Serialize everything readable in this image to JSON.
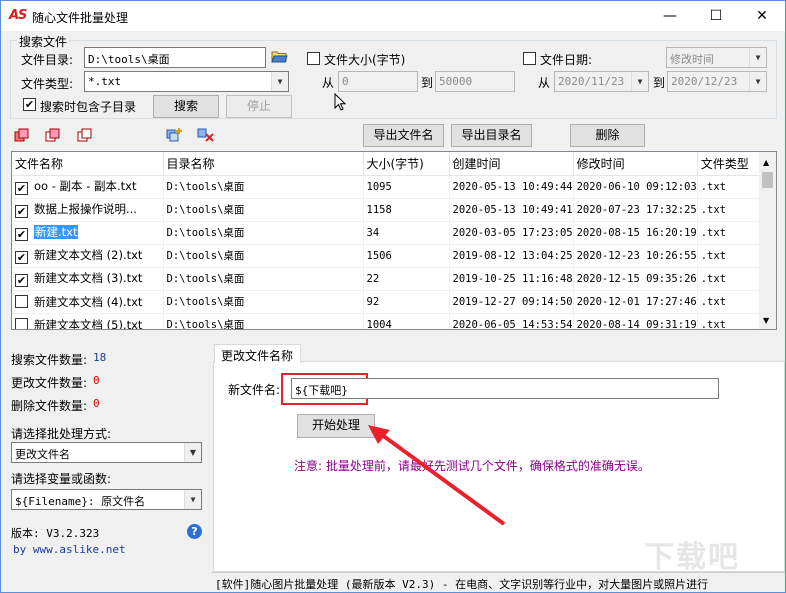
{
  "window": {
    "app_icon": "AS",
    "title": "随心文件批量处理",
    "minimize": "—",
    "maximize": "☐",
    "close": "✕"
  },
  "search": {
    "group_label": "搜索文件",
    "dir_label": "文件目录:",
    "dir_value": "D:\\tools\\桌面",
    "type_label": "文件类型:",
    "type_value": "*.txt",
    "include_sub_label": "搜索时包含子目录",
    "include_sub_checked": "✔",
    "search_button": "搜索",
    "stop_button": "停止",
    "size_label": "文件大小(字节)",
    "size_from_label": "从",
    "size_from_value": "0",
    "size_to_label": "到",
    "size_to_value": "50000",
    "date_label": "文件日期:",
    "date_mode_value": "修改时间",
    "date_from_label": "从",
    "date_from_value": "2020/11/23",
    "date_to_label": "到",
    "date_to_value": "2020/12/23"
  },
  "toolbar": {
    "export_files": "导出文件名",
    "export_dirs": "导出目录名",
    "delete": "删除"
  },
  "table": {
    "headers": [
      "文件名称",
      "目录名称",
      "大小(字节)",
      "创建时间",
      "修改时间",
      "文件类型"
    ],
    "rows": [
      {
        "checked": "✔",
        "name": "oo - 副本 - 副本.txt",
        "dir": "D:\\tools\\桌面",
        "size": "1095",
        "created": "2020-05-13 10:49:44",
        "modified": "2020-06-10 09:12:03",
        "type": ".txt"
      },
      {
        "checked": "✔",
        "name": "数据上报操作说明...",
        "dir": "D:\\tools\\桌面",
        "size": "1158",
        "created": "2020-05-13 10:49:41",
        "modified": "2020-07-23 17:32:25",
        "type": ".txt"
      },
      {
        "checked": "✔",
        "name": "新建.txt",
        "dir": "D:\\tools\\桌面",
        "size": "34",
        "created": "2020-03-05 17:23:05",
        "modified": "2020-08-15 16:20:19",
        "type": ".txt"
      },
      {
        "checked": "✔",
        "name": "新建文本文档 (2).txt",
        "dir": "D:\\tools\\桌面",
        "size": "1506",
        "created": "2019-08-12 13:04:25",
        "modified": "2020-12-23 10:26:55",
        "type": ".txt"
      },
      {
        "checked": "✔",
        "name": "新建文本文档 (3).txt",
        "dir": "D:\\tools\\桌面",
        "size": "22",
        "created": "2019-10-25 11:16:48",
        "modified": "2020-12-15 09:35:26",
        "type": ".txt"
      },
      {
        "checked": "",
        "name": "新建文本文档 (4).txt",
        "dir": "D:\\tools\\桌面",
        "size": "92",
        "created": "2019-12-27 09:14:50",
        "modified": "2020-12-01 17:27:46",
        "type": ".txt"
      },
      {
        "checked": "",
        "name": "新建文本文档 (5).txt",
        "dir": "D:\\tools\\桌面",
        "size": "1004",
        "created": "2020-06-05 14:53:54",
        "modified": "2020-08-14 09:31:19",
        "type": ".txt"
      }
    ]
  },
  "stats": {
    "found_label": "搜索文件数量:",
    "found_value": "18",
    "changed_label": "更改文件数量:",
    "changed_value": "0",
    "deleted_label": "删除文件数量:",
    "deleted_value": "0"
  },
  "method": {
    "label": "请选择批处理方式:",
    "value": "更改文件名"
  },
  "variable": {
    "label": "请选择变量或函数:",
    "value": "${Filename}: 原文件名"
  },
  "about": {
    "version": "版本: V3.2.323",
    "site": "by www.aslike.net",
    "help_glyph": "?"
  },
  "rename": {
    "tab_label": "更改文件名称",
    "new_name_label": "新文件名:",
    "new_name_value": "${下载吧}",
    "start_button": "开始处理",
    "note": "注意: 批量处理前，请最好先测试几个文件，确保格式的准确无误。"
  },
  "statusbar": {
    "text": "[软件]随心图片批量处理 (最新版本 V2.3)  - 在电商、文字识别等行业中，对大量图片或照片进行"
  },
  "watermark": {
    "text": "下载吧"
  },
  "colors": {
    "accent_red": "#e8212b",
    "stat_blue": "#1a3c9c",
    "stat_red": "#d40000",
    "note_purple": "#8b008b",
    "selection": "#3399ff"
  }
}
